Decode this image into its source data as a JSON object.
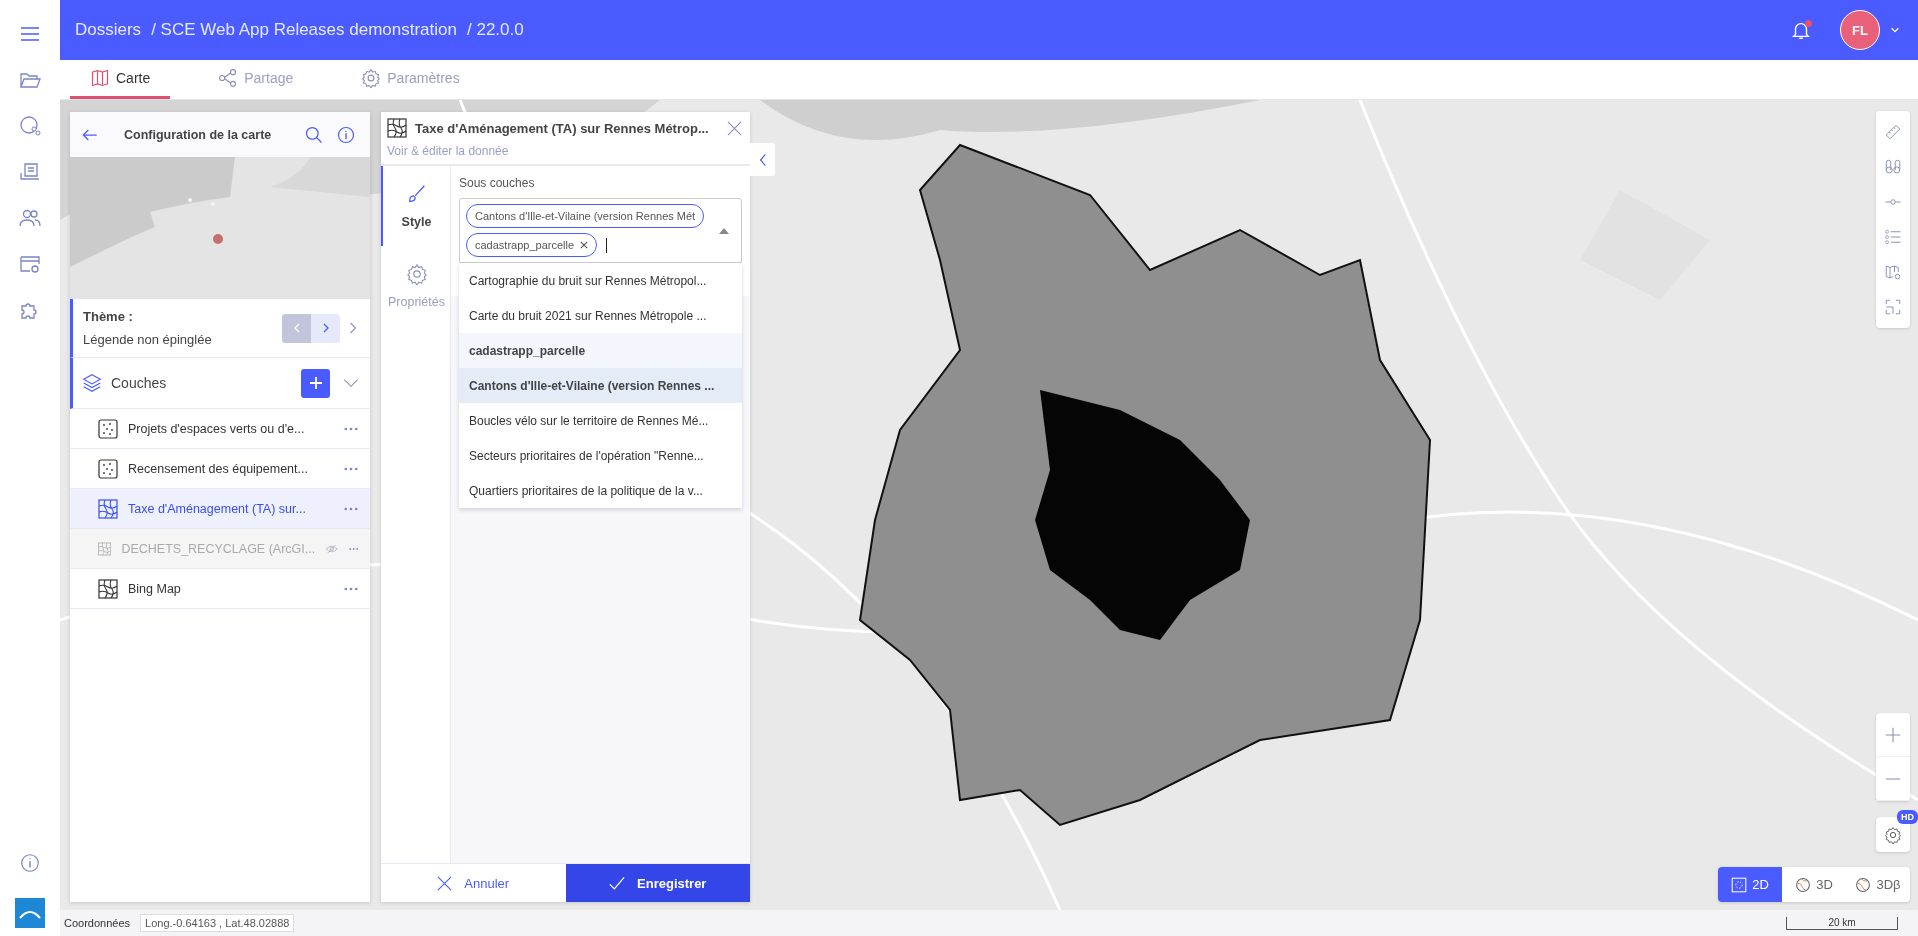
{
  "breadcrumb": {
    "root": "Dossiers",
    "items": [
      "/ SCE Web App Releases demonstration",
      "/ 22.0.0"
    ]
  },
  "notifications": {
    "unread": true
  },
  "user": {
    "initials": "FL"
  },
  "tabs": [
    {
      "label": "Carte",
      "selected": true
    },
    {
      "label": "Partage",
      "selected": false
    },
    {
      "label": "Paramètres",
      "selected": false
    }
  ],
  "config_panel": {
    "title": "Configuration de la carte",
    "theme": {
      "label": "Thème :",
      "value": "Légende non épinglée"
    },
    "layers_title": "Couches",
    "layers": [
      {
        "name": "Projets d'espaces verts ou d'e...",
        "kind": "points",
        "selected": false,
        "visible": true
      },
      {
        "name": "Recensement des équipement...",
        "kind": "points",
        "selected": false,
        "visible": true
      },
      {
        "name": "Taxe d'Aménagement (TA) sur...",
        "kind": "polygon",
        "selected": true,
        "visible": true
      },
      {
        "name": "DECHETS_RECYCLAGE (ArcGI...",
        "kind": "polygon",
        "selected": false,
        "visible": false
      },
      {
        "name": "Bing Map",
        "kind": "polygon",
        "selected": false,
        "visible": true
      }
    ]
  },
  "layer_editor": {
    "title": "Taxe d'Aménagement (TA) sur Rennes Métrop...",
    "subtitle": "Voir & éditer la donnée",
    "side_tabs": [
      {
        "label": "Style",
        "selected": true
      },
      {
        "label": "Propriétés",
        "selected": false
      }
    ],
    "field_label": "Sous couches",
    "chips": [
      "Cantons d'Ille-et-Vilaine (version Rennes Mét",
      "cadastrapp_parcelle"
    ],
    "options": [
      {
        "label": "Cartographie du bruit sur Rennes Métropol...",
        "selected": false,
        "highlighted": false
      },
      {
        "label": "Carte du bruit 2021 sur Rennes Métropole ...",
        "selected": false,
        "highlighted": false
      },
      {
        "label": "cadastrapp_parcelle",
        "selected": true,
        "highlighted": false
      },
      {
        "label": "Cantons d'Ille-et-Vilaine (version Rennes ...",
        "selected": true,
        "highlighted": true
      },
      {
        "label": "Boucles vélo sur le territoire de Rennes Mé...",
        "selected": false,
        "highlighted": false
      },
      {
        "label": "Secteurs prioritaires de l'opération \"Renne...",
        "selected": false,
        "highlighted": false
      },
      {
        "label": "Quartiers prioritaires de la politique de la v...",
        "selected": false,
        "highlighted": false
      }
    ],
    "cancel": "Annuler",
    "save": "Enregistrer"
  },
  "hd_badge": "HD",
  "view_modes": [
    {
      "label": "2D",
      "selected": true
    },
    {
      "label": "3D",
      "selected": false
    },
    {
      "label": "3Dβ",
      "selected": false
    }
  ],
  "status_bar": {
    "label": "Coordonnées",
    "coordinates": "Long.-0.64163 , Lat.48.02888",
    "scale": "20 km"
  }
}
